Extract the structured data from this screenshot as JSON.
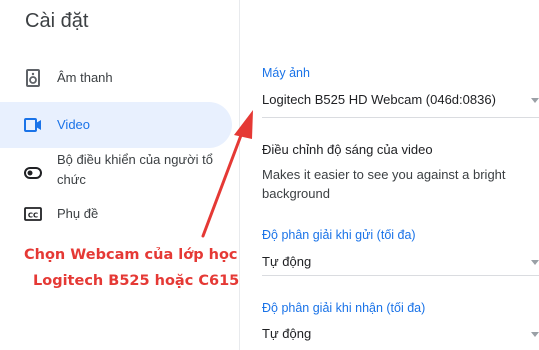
{
  "sidebar": {
    "title": "Cài đặt",
    "items": [
      {
        "label": "Âm thanh",
        "icon": "speaker-icon"
      },
      {
        "label": "Video",
        "icon": "video-camera-icon",
        "active": true
      },
      {
        "label": "Bộ điều khiển của người tổ chức",
        "icon": "toggle-icon"
      },
      {
        "label": "Phụ đề",
        "icon": "captions-icon"
      }
    ]
  },
  "main": {
    "camera": {
      "label": "Máy ảnh",
      "value": "Logitech B525 HD Webcam (046d:0836)"
    },
    "brightness": {
      "heading": "Điều chỉnh độ sáng của video",
      "description": "Makes it easier to see you against a bright background"
    },
    "send_resolution": {
      "label": "Độ phân giải khi gửi (tối đa)",
      "value": "Tự động"
    },
    "receive_resolution": {
      "label": "Độ phân giải khi nhận (tối đa)",
      "value": "Tự động"
    }
  },
  "annotation": {
    "line1": "Chọn Webcam của lớp học",
    "line2": "Logitech B525 hoặc C615",
    "color": "#e53935"
  },
  "colors": {
    "accent": "#1a73e8",
    "active_bg": "#e8f0fe"
  }
}
